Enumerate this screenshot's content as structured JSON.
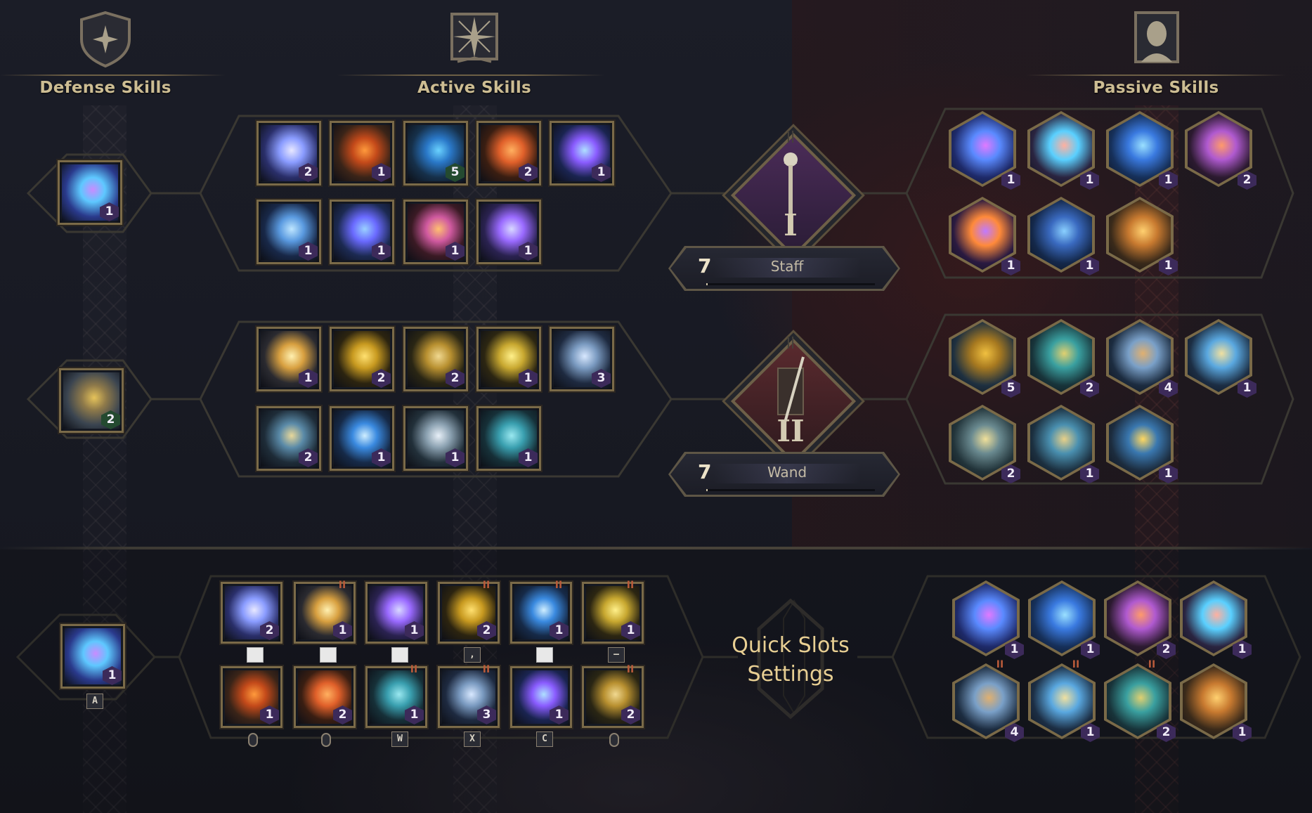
{
  "categories": {
    "defense": {
      "title": "Defense Skills",
      "icon": "shield-star-icon"
    },
    "active": {
      "title": "Active Skills",
      "icon": "compass-star-book-icon"
    },
    "passive": {
      "title": "Passive Skills",
      "icon": "head-bust-icon"
    }
  },
  "weapons": [
    {
      "tier": "I",
      "level": "7",
      "name": "Staff",
      "progress": 0.01,
      "icon": "staff-icon"
    },
    {
      "tier": "II",
      "level": "7",
      "name": "Wand",
      "progress": 0.01,
      "icon": "wand-icon"
    }
  ],
  "defense_skills": [
    {
      "level": "1",
      "icon": "arcane-vortex-icon",
      "badge": "purple"
    },
    {
      "level": "2",
      "icon": "holy-shield-icon",
      "badge": "green"
    }
  ],
  "active_skills_staff": [
    [
      {
        "level": "2",
        "icon": "lightning-bolt-icon",
        "badge": "purple"
      },
      {
        "level": "1",
        "icon": "fire-slash-icon",
        "badge": "purple"
      },
      {
        "level": "5",
        "icon": "frost-ring-icon",
        "badge": "green"
      },
      {
        "level": "2",
        "icon": "flame-eruption-icon",
        "badge": "purple"
      },
      {
        "level": "1",
        "icon": "ice-spirit-icon",
        "badge": "purple"
      }
    ],
    [
      {
        "level": "1",
        "icon": "ice-crystal-icon",
        "badge": "purple"
      },
      {
        "level": "1",
        "icon": "ice-shard-icon",
        "badge": "purple"
      },
      {
        "level": "1",
        "icon": "meteor-icon",
        "badge": "purple"
      },
      {
        "level": "1",
        "icon": "chain-lightning-icon",
        "badge": "purple"
      }
    ]
  ],
  "active_skills_wand": [
    [
      {
        "level": "1",
        "icon": "holy-orb-icon",
        "badge": "purple"
      },
      {
        "level": "2",
        "icon": "golden-whirl-icon",
        "badge": "purple"
      },
      {
        "level": "2",
        "icon": "cross-blessing-icon",
        "badge": "purple"
      },
      {
        "level": "1",
        "icon": "golden-burst-icon",
        "badge": "purple"
      },
      {
        "level": "3",
        "icon": "sleep-moon-icon",
        "badge": "purple"
      }
    ],
    [
      {
        "level": "2",
        "icon": "holy-cross-icon",
        "badge": "purple"
      },
      {
        "level": "1",
        "icon": "blue-flare-icon",
        "badge": "purple"
      },
      {
        "level": "1",
        "icon": "angel-wings-icon",
        "badge": "purple"
      },
      {
        "level": "1",
        "icon": "healing-hand-icon",
        "badge": "purple"
      }
    ]
  ],
  "passive_skills_staff": [
    [
      {
        "level": "1",
        "icon": "arcane-swirl-icon"
      },
      {
        "level": "1",
        "icon": "frost-flame-icon"
      },
      {
        "level": "1",
        "icon": "water-orb-icon"
      },
      {
        "level": "2",
        "icon": "fire-vortex-icon"
      }
    ],
    [
      {
        "level": "1",
        "icon": "demon-mask-icon"
      },
      {
        "level": "1",
        "icon": "ice-skull-icon"
      },
      {
        "level": "1",
        "icon": "phoenix-icon"
      }
    ]
  ],
  "passive_skills_wand": [
    [
      {
        "level": "5",
        "icon": "golden-chalice-icon"
      },
      {
        "level": "2",
        "icon": "all-seeing-eye-icon"
      },
      {
        "level": "4",
        "icon": "hourglass-icon"
      },
      {
        "level": "1",
        "icon": "cross-swirl-icon"
      }
    ],
    [
      {
        "level": "2",
        "icon": "ascending-cross-icon"
      },
      {
        "level": "1",
        "icon": "sacred-cross-icon"
      },
      {
        "level": "1",
        "icon": "holy-droplet-icon"
      }
    ]
  ],
  "quick_slots": {
    "title_line1": "Quick Slots",
    "title_line2": "Settings",
    "defense": {
      "level": "1",
      "icon": "arcane-vortex-icon",
      "key": "A"
    },
    "active_top": [
      {
        "level": "2",
        "icon": "lightning-bolt-icon",
        "key": "",
        "key_style": "white",
        "tier_mark": ""
      },
      {
        "level": "1",
        "icon": "holy-orb-icon",
        "key": "",
        "key_style": "white",
        "tier_mark": "II"
      },
      {
        "level": "1",
        "icon": "chain-lightning-icon",
        "key": "",
        "key_style": "white",
        "tier_mark": ""
      },
      {
        "level": "2",
        "icon": "golden-whirl-icon",
        "key": ",",
        "key_style": "dark",
        "tier_mark": "II"
      },
      {
        "level": "1",
        "icon": "blue-flare-icon",
        "key": "",
        "key_style": "white",
        "tier_mark": "II"
      },
      {
        "level": "1",
        "icon": "golden-burst-icon",
        "key": "–",
        "key_style": "dark",
        "tier_mark": "II"
      }
    ],
    "active_bottom": [
      {
        "level": "1",
        "icon": "fire-slash-icon",
        "key": "",
        "key_style": "mouse",
        "tier_mark": ""
      },
      {
        "level": "2",
        "icon": "flame-eruption-icon",
        "key": "",
        "key_style": "mouse",
        "tier_mark": ""
      },
      {
        "level": "1",
        "icon": "healing-hand-icon",
        "key": "W",
        "key_style": "dark",
        "tier_mark": "II"
      },
      {
        "level": "3",
        "icon": "sleep-moon-icon",
        "key": "X",
        "key_style": "dark",
        "tier_mark": "II"
      },
      {
        "level": "1",
        "icon": "ice-spirit-icon",
        "key": "C",
        "key_style": "dark",
        "tier_mark": ""
      },
      {
        "level": "2",
        "icon": "cross-blessing-icon",
        "key": "",
        "key_style": "mouse",
        "tier_mark": "II"
      }
    ],
    "passive_top": [
      {
        "level": "1",
        "icon": "arcane-swirl-icon",
        "tier_mark": ""
      },
      {
        "level": "1",
        "icon": "water-orb-icon",
        "tier_mark": ""
      },
      {
        "level": "2",
        "icon": "fire-vortex-icon",
        "tier_mark": ""
      },
      {
        "level": "1",
        "icon": "frost-flame-icon",
        "tier_mark": ""
      }
    ],
    "passive_bottom": [
      {
        "level": "4",
        "icon": "hourglass-icon",
        "tier_mark": "II"
      },
      {
        "level": "1",
        "icon": "cross-swirl-icon",
        "tier_mark": "II"
      },
      {
        "level": "2",
        "icon": "all-seeing-eye-icon",
        "tier_mark": "II"
      },
      {
        "level": "1",
        "icon": "phoenix-icon",
        "tier_mark": ""
      }
    ]
  },
  "colors": {
    "frame_gold": "#7a6a48",
    "badge_purple": "#3c2a5a",
    "badge_green": "#244a30",
    "quick_slots_text": "#e8cf93",
    "header_text": "#cdbd93"
  }
}
